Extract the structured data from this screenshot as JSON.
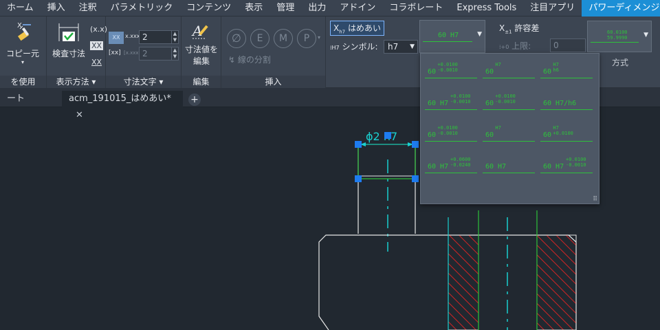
{
  "menu": {
    "items": [
      "ホーム",
      "挿入",
      "注釈",
      "パラメトリック",
      "コンテンツ",
      "表示",
      "管理",
      "出力",
      "アドイン",
      "コラボレート",
      "Express Tools",
      "注目アプリ",
      "パワーディメンジョン"
    ],
    "active_index": 12
  },
  "ribbon": {
    "use_panel": {
      "copy_label": "コピー元",
      "title": "を使用"
    },
    "display_panel": {
      "inspect_label": "検査寸法",
      "title": "表示方法",
      "small_icons": [
        "(x.x)",
        "XX",
        "XX"
      ]
    },
    "text_panel": {
      "title": "寸法文字",
      "value1": "2",
      "value2": "2",
      "tag1": "XX",
      "tag1b": "x.xxx",
      "tag2": "[xx]",
      "tag2b": "[x.xxx]"
    },
    "edit_panel": {
      "label_line1": "寸法値を",
      "label_line2": "編集",
      "title": "編集"
    },
    "insert_panel": {
      "symbols": [
        "∅",
        "E",
        "M",
        "P"
      ],
      "split_label": "線の分割",
      "title": "挿入"
    },
    "fit_panel": {
      "fit_label": "はめあい",
      "symbol_label": "シンボル:",
      "symbol_value": "h7",
      "preview_text": "60 H7"
    },
    "tol_panel": {
      "tol_label": "許容差",
      "upper_label": "上限:",
      "upper_value": "0",
      "method_title": "方式",
      "preview_top": "60.0100",
      "preview_bottom": "59.9990"
    }
  },
  "tabs": {
    "left_partial": "ート",
    "active": "acm_191015_はめあい*",
    "close": "✕",
    "plus": "+"
  },
  "drawing": {
    "dim_text": "ϕ2  h7",
    "colors": {
      "white": "#e8e8e8",
      "cyan": "#19d0d0",
      "green": "#2ec23b",
      "red": "#d22424",
      "grip": "#1e7cf0"
    }
  },
  "gallery": {
    "cells": [
      {
        "main": "60",
        "tol_top": "+0.0100",
        "tol_bottom": "-0.0010"
      },
      {
        "main": "60",
        "tol_top": "H7",
        "tol_bottom": ""
      },
      {
        "main": "60",
        "tol_top": "H7",
        "tol_bottom": "h6"
      },
      {
        "main": "60 H7",
        "tol_top": "+0.0100",
        "tol_bottom": "-0.0010"
      },
      {
        "main": "60",
        "tol_top": "+0.0100",
        "tol_bottom": "-0.0010"
      },
      {
        "main": "60 H7/h6",
        "tol_top": "",
        "tol_bottom": ""
      },
      {
        "main": "60",
        "tol_top": "+0.0100",
        "tol_bottom": "-0.0010"
      },
      {
        "main": "60",
        "tol_top": "H7",
        "tol_bottom": ""
      },
      {
        "main": "60",
        "tol_top": "H7",
        "tol_bottom": "+0.0100"
      },
      {
        "main": "60 H7",
        "tol_top": "+0.0600",
        "tol_bottom": "-0.0240"
      },
      {
        "main": "60 H7",
        "tol_top": "",
        "tol_bottom": ""
      },
      {
        "main": "60 H7",
        "tol_top": "+0.0100",
        "tol_bottom": "-0.0010"
      }
    ]
  }
}
